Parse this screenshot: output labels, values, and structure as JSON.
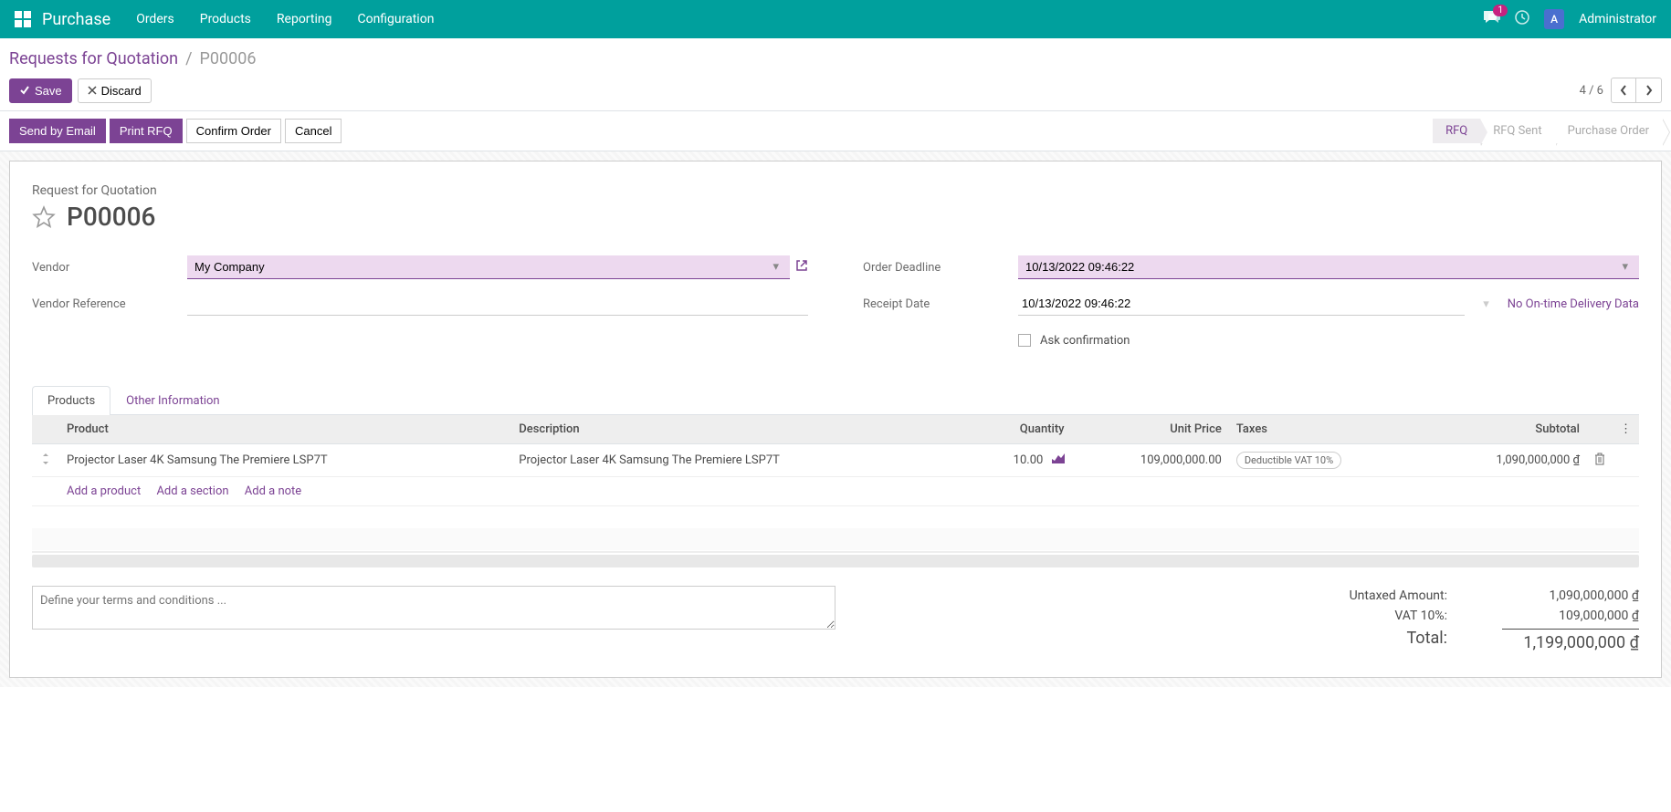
{
  "navbar": {
    "brand": "Purchase",
    "menu": [
      "Orders",
      "Products",
      "Reporting",
      "Configuration"
    ],
    "chat_badge": "1",
    "user_initial": "A",
    "user_name": "Administrator"
  },
  "breadcrumb": {
    "parent": "Requests for Quotation",
    "current": "P00006"
  },
  "buttons": {
    "save": "Save",
    "discard": "Discard",
    "send_email": "Send by Email",
    "print_rfq": "Print RFQ",
    "confirm": "Confirm Order",
    "cancel": "Cancel"
  },
  "pager": {
    "text": "4 / 6"
  },
  "status_steps": {
    "rfq": "RFQ",
    "rfq_sent": "RFQ Sent",
    "po": "Purchase Order"
  },
  "sheet": {
    "title_label": "Request for Quotation",
    "title": "P00006"
  },
  "form": {
    "vendor_label": "Vendor",
    "vendor_value": "My Company",
    "vendor_ref_label": "Vendor Reference",
    "vendor_ref_value": "",
    "deadline_label": "Order Deadline",
    "deadline_value": "10/13/2022 09:46:22",
    "receipt_label": "Receipt Date",
    "receipt_value": "10/13/2022 09:46:22",
    "delivery_link": "No On-time Delivery Data",
    "ask_confirmation": "Ask confirmation"
  },
  "tabs": {
    "products": "Products",
    "other": "Other Information"
  },
  "table": {
    "headers": {
      "product": "Product",
      "description": "Description",
      "quantity": "Quantity",
      "unit_price": "Unit Price",
      "taxes": "Taxes",
      "subtotal": "Subtotal"
    },
    "rows": [
      {
        "product": "Projector Laser 4K Samsung The Premiere LSP7T",
        "description": "Projector Laser 4K Samsung The Premiere LSP7T",
        "quantity": "10.00",
        "unit_price": "109,000,000.00",
        "tax": "Deductible VAT 10%",
        "subtotal": "1,090,000,000 ₫"
      }
    ],
    "add_product": "Add a product",
    "add_section": "Add a section",
    "add_note": "Add a note"
  },
  "terms_placeholder": "Define your terms and conditions ...",
  "totals": {
    "untaxed_label": "Untaxed Amount:",
    "untaxed_value": "1,090,000,000 ₫",
    "vat_label": "VAT 10%:",
    "vat_value": "109,000,000 ₫",
    "total_label": "Total:",
    "total_value": "1,199,000,000 ₫"
  }
}
